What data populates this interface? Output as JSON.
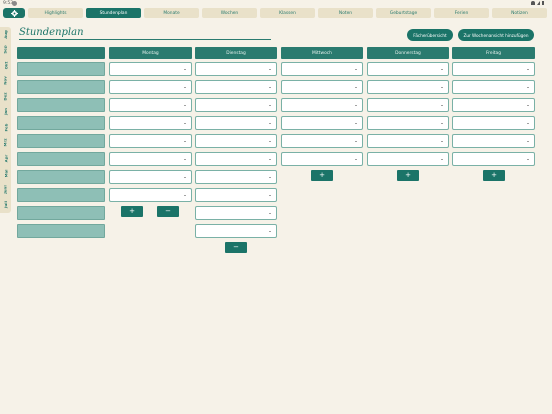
{
  "status_bar": {
    "time": "9:53"
  },
  "nav": {
    "tabs": [
      {
        "label": "Highlights",
        "active": false
      },
      {
        "label": "Stundenplan",
        "active": true
      },
      {
        "label": "Monate",
        "active": false
      },
      {
        "label": "Wochen",
        "active": false
      },
      {
        "label": "Klassen",
        "active": false
      },
      {
        "label": "Noten",
        "active": false
      },
      {
        "label": "Geburtstage",
        "active": false
      },
      {
        "label": "Ferien",
        "active": false
      },
      {
        "label": "Notizen",
        "active": false
      }
    ]
  },
  "months": [
    "Aug",
    "Sep",
    "Okt",
    "Nov",
    "Dez",
    "Jan",
    "Feb",
    "Mrz",
    "Apr",
    "Mai",
    "Juni",
    "Juli"
  ],
  "page": {
    "title": "Stundenplan"
  },
  "header_buttons": {
    "subject_overview": "Fächerübersicht",
    "add_to_week": "Zur Wochenansicht hinzufügen"
  },
  "days": [
    {
      "name": "Montag",
      "slots": 8
    },
    {
      "name": "Dienstag",
      "slots": 10
    },
    {
      "name": "Mittwoch",
      "slots": 6
    },
    {
      "name": "Donnerstag",
      "slots": 6
    },
    {
      "name": "Freitag",
      "slots": 6
    }
  ],
  "controls": {
    "add_symbol": "+",
    "remove_symbol": "−"
  },
  "colors": {
    "primary": "#1b7468",
    "header": "#2a7b6f",
    "background": "#f6f2e8",
    "tab_inactive": "#e9e1c9",
    "lesson_cell": "#8ebfb6"
  }
}
